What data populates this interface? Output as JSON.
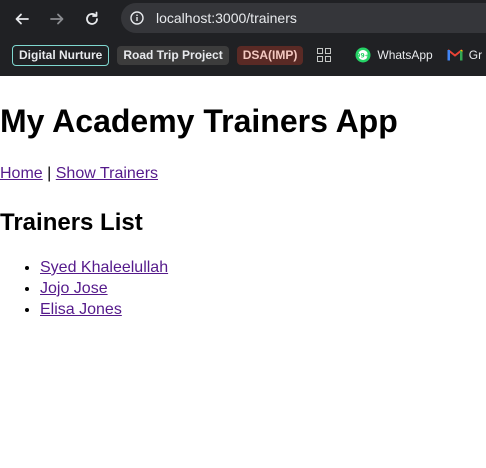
{
  "browser": {
    "url": "localhost:3000/trainers",
    "bookmarks": [
      {
        "label": "Digital Nurture"
      },
      {
        "label": "Road Trip Project"
      },
      {
        "label": "DSA(IMP)"
      }
    ],
    "links": [
      {
        "label": "WhatsApp",
        "icon": "whatsapp-icon"
      },
      {
        "label": "Gr",
        "icon": "gmail-icon"
      }
    ]
  },
  "page": {
    "title": "My Academy Trainers App",
    "nav": {
      "home": "Home",
      "separator": "|",
      "show_trainers": "Show Trainers"
    },
    "list_heading": "Trainers List",
    "trainers": [
      "Syed Khaleelullah",
      "Jojo Jose",
      "Elisa Jones"
    ]
  }
}
